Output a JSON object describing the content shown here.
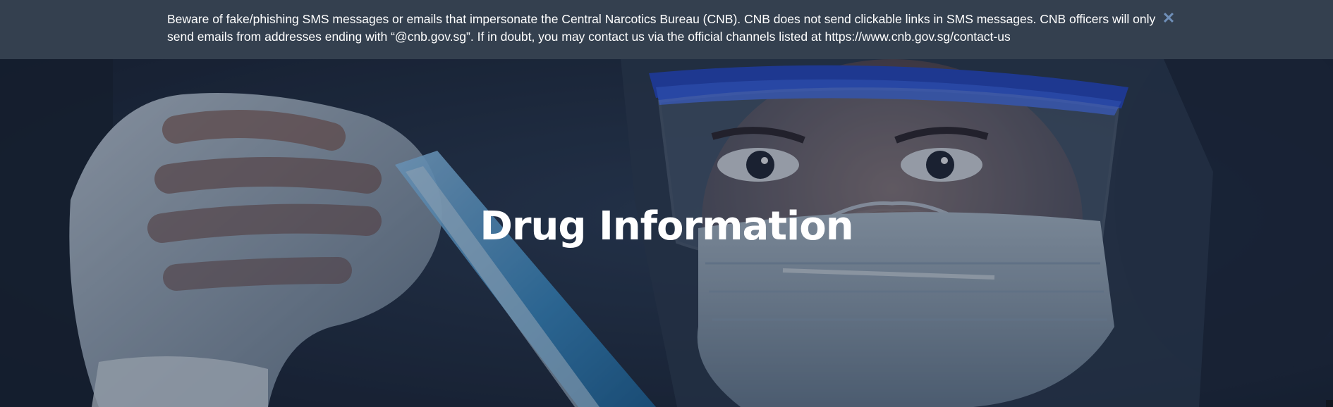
{
  "alert": {
    "message": "Beware of fake/phishing SMS messages or emails that impersonate the Central Narcotics Bureau (CNB). CNB does not send clickable links in SMS messages. CNB officers will only send emails from addresses ending with “@cnb.gov.sg”. If in doubt, you may contact us via the official channels listed at https://www.cnb.gov.sg/contact-us",
    "close_icon": "close-icon",
    "close_glyph": "✕"
  },
  "hero": {
    "title": "Drug Information",
    "image": "lab-scientist-test-tube-photo"
  },
  "colors": {
    "alert_bg": "#34404f",
    "alert_close": "#6f8fb8",
    "hero_overlay": "#1d2a3c",
    "title_text": "#ffffff"
  }
}
